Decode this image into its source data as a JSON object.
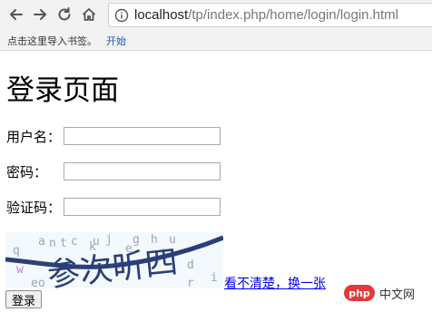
{
  "browser": {
    "url_host": "localhost",
    "url_path": "/tp/index.php/home/login/login.html",
    "bookmarks_hint": "点击这里导入书签。",
    "bookmarks_start": "开始"
  },
  "page": {
    "title": "登录页面",
    "fields": [
      {
        "label": "用户名：",
        "value": ""
      },
      {
        "label": "密码：",
        "value": ""
      },
      {
        "label": "验证码：",
        "value": ""
      }
    ],
    "captcha_text": "参次听四",
    "captcha_noise": [
      "j",
      "g",
      "h",
      "u",
      "n",
      "c",
      "t",
      "e",
      "k",
      "q",
      "i",
      "w",
      "a",
      "d",
      "r",
      "u",
      "e",
      "r",
      "i",
      "o"
    ],
    "refresh_link": "看不清楚，换一张",
    "login_button": "登录"
  },
  "watermark": {
    "logo": "php",
    "text": "中文网"
  }
}
